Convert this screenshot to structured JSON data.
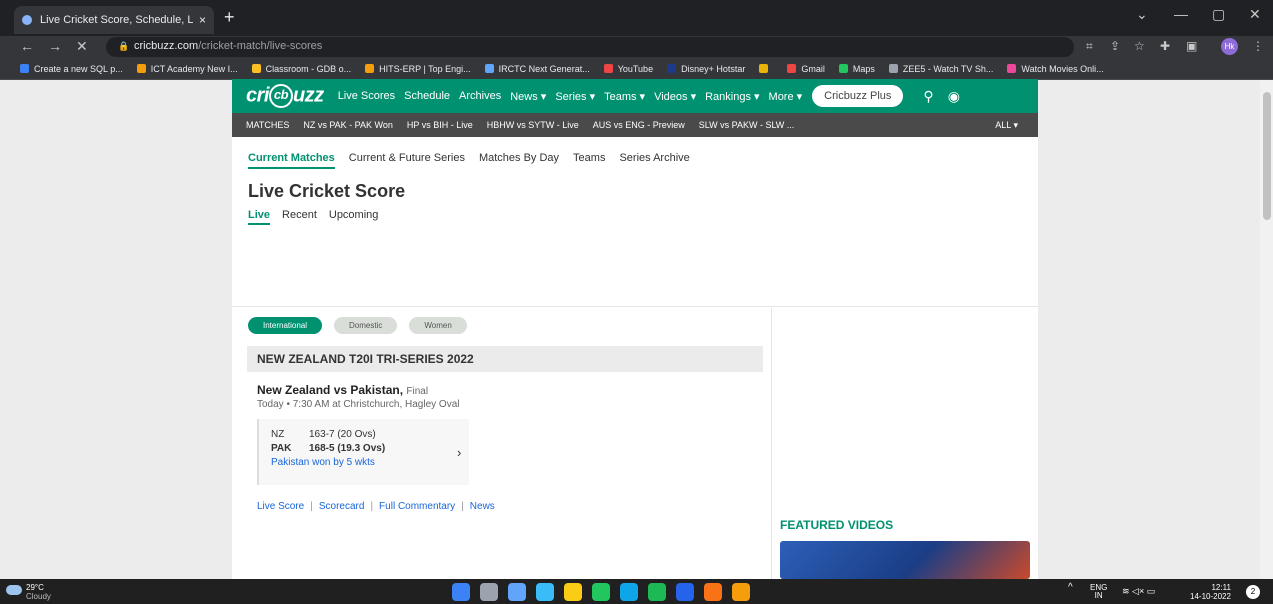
{
  "browser": {
    "tab_title": "Live Cricket Score, Schedule, Lat",
    "tab_close": "×",
    "new_tab": "+",
    "url_host": "cricbuzz.com",
    "url_path": "/cricket-match/live-scores",
    "profile_initials": "Hk",
    "nav_back": "←",
    "nav_forward": "→",
    "nav_stop": "✕",
    "window_controls": {
      "minimize": "—",
      "maximize": "▢",
      "close": "✕",
      "dropdown": "⌄"
    },
    "bookmarks": [
      {
        "label": "Create a new SQL p...",
        "color": "#3b82f6"
      },
      {
        "label": "ICT Academy New I...",
        "color": "#f59e0b"
      },
      {
        "label": "Classroom - GDB o...",
        "color": "#fbbf24"
      },
      {
        "label": "HITS-ERP | Top Engi...",
        "color": "#f59e0b"
      },
      {
        "label": "IRCTC Next Generat...",
        "color": "#60a5fa"
      },
      {
        "label": "YouTube",
        "color": "#ef4444"
      },
      {
        "label": "Disney+ Hotstar",
        "color": "#1e3a8a"
      },
      {
        "label": "",
        "color": "#eab308"
      },
      {
        "label": "Gmail",
        "color": "#ef4444"
      },
      {
        "label": "Maps",
        "color": "#22c55e"
      },
      {
        "label": "ZEE5 - Watch TV Sh...",
        "color": "#9ca3af"
      },
      {
        "label": "Watch Movies Onli...",
        "color": "#ec4899"
      }
    ]
  },
  "site": {
    "logo_pre": "cri",
    "logo_mid": "cb",
    "logo_post": "uzz",
    "nav": [
      "Live Scores",
      "Schedule",
      "Archives",
      "News ▾",
      "Series ▾",
      "Teams ▾",
      "Videos ▾",
      "Rankings ▾",
      "More ▾"
    ],
    "plus_button": "Cricbuzz Plus",
    "search_glyph": "⚲",
    "profile_glyph": "◉",
    "subnav": [
      "MATCHES",
      "NZ vs PAK - PAK Won",
      "HP vs BIH - Live",
      "HBHW vs SYTW - Live",
      "AUS vs ENG - Preview",
      "SLW vs PAKW - SLW ..."
    ],
    "subnav_all": "ALL ▾",
    "tabs": [
      "Current Matches",
      "Current & Future Series",
      "Matches By Day",
      "Teams",
      "Series Archive"
    ],
    "page_title": "Live Cricket Score",
    "subtabs": [
      "Live",
      "Recent",
      "Upcoming"
    ],
    "filters": [
      "International",
      "Domestic",
      "Women"
    ],
    "series_title": "NEW ZEALAND T20I TRI-SERIES 2022",
    "match": {
      "title": "New Zealand vs Pakistan,",
      "status": "Final",
      "meta": "Today • 7:30 AM at Christchurch, Hagley Oval",
      "team1": "NZ",
      "score1": "163-7 (20 Ovs)",
      "team2": "PAK",
      "score2": "168-5 (19.3 Ovs)",
      "result": "Pakistan won by 5 wkts",
      "chevron": "›"
    },
    "links": [
      "Live Score",
      "Scorecard",
      "Full Commentary",
      "News"
    ],
    "link_separator": "|",
    "featured_title": "FEATURED VIDEOS"
  },
  "taskbar": {
    "temp": "29°C",
    "weather": "Cloudy",
    "lang": "ENG",
    "lang_region": "IN",
    "time": "12:11",
    "date": "14-10-2022",
    "notification_count": "2",
    "tray_chevron": "^",
    "tray_icons": "≋ ◁× ▭",
    "icon_colors": [
      "#3b82f6",
      "#9ca3af",
      "#60a5fa",
      "#38bdf8",
      "#facc15",
      "#22c55e",
      "#0ea5e9",
      "#1db954",
      "#2563eb",
      "#f97316",
      "#f59e0b"
    ]
  }
}
